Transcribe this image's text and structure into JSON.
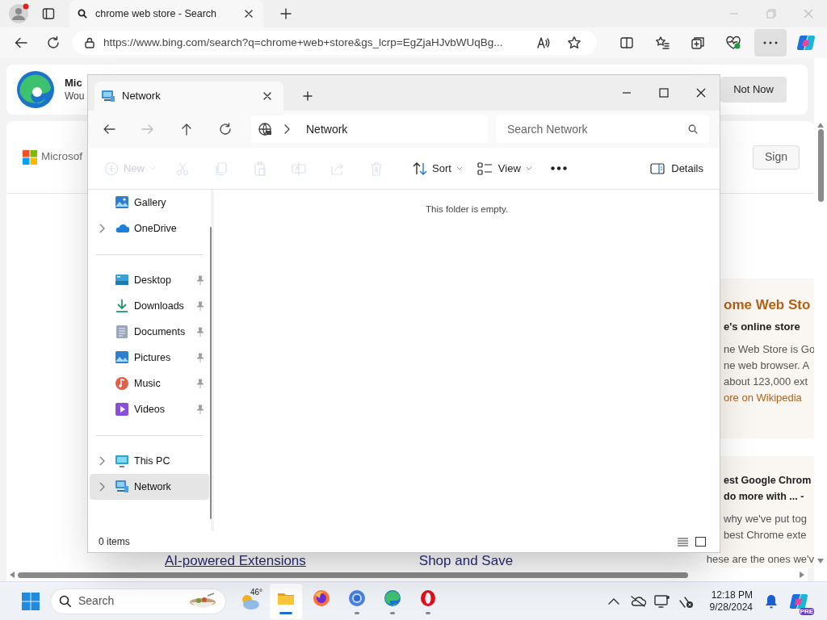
{
  "browser": {
    "tabs": [
      {
        "title": "chrome web store - Search",
        "selected": true
      }
    ],
    "address": "https://www.bing.com/search?q=chrome+web+store&gs_lcrp=EgZjaHJvbWUqBg...",
    "banner": {
      "title": "Mic",
      "subtitle": "Wou",
      "button": "Not Now"
    },
    "logo_text": "Microsof",
    "sign_in": "Sign",
    "cards": [
      {
        "title": "ome Web Sto",
        "subtitle": "e's online store",
        "lines": [
          "ne Web Store is Go",
          "ne web browser. A",
          "about 123,000 ext"
        ],
        "link": "ore on Wikipedia"
      },
      {
        "title": "est Google Chrom",
        "subtitle": "do more with ... -",
        "lines": [
          "why we've put tog",
          "best Chrome exte",
          "hese are the ones we'v"
        ]
      }
    ],
    "links": [
      "AI-powered Extensions",
      "Shop and Save"
    ]
  },
  "explorer": {
    "tabs": [
      {
        "title": "Network",
        "selected": true
      }
    ],
    "path": "Network",
    "search": {
      "placeholder": "Search Network"
    },
    "toolbar": [
      {
        "kind": "new",
        "label": "New",
        "disabled": true
      },
      {
        "kind": "cut",
        "disabled": true
      },
      {
        "kind": "copy",
        "disabled": true
      },
      {
        "kind": "paste",
        "disabled": true
      },
      {
        "kind": "rename",
        "disabled": true
      },
      {
        "kind": "share",
        "disabled": true
      },
      {
        "kind": "delete",
        "disabled": true
      },
      {
        "kind": "sort",
        "label": "Sort",
        "disabled": false
      },
      {
        "kind": "view",
        "label": "View",
        "disabled": false
      },
      {
        "kind": "more",
        "disabled": false
      }
    ],
    "details": "Details",
    "sidebar": [
      [
        {
          "label": "Gallery",
          "kind": "gallery",
          "has_children": false,
          "pinned": false,
          "selected": false
        },
        {
          "label": "OneDrive",
          "kind": "cloud",
          "has_children": true,
          "pinned": false,
          "selected": false
        }
      ],
      [
        {
          "label": "Desktop",
          "kind": "desktop",
          "has_children": false,
          "pinned": true,
          "selected": false
        },
        {
          "label": "Downloads",
          "kind": "download",
          "has_children": false,
          "pinned": true,
          "selected": false
        },
        {
          "label": "Documents",
          "kind": "document",
          "has_children": false,
          "pinned": true,
          "selected": false
        },
        {
          "label": "Pictures",
          "kind": "pictures",
          "has_children": false,
          "pinned": true,
          "selected": false
        },
        {
          "label": "Music",
          "kind": "music",
          "has_children": false,
          "pinned": true,
          "selected": false
        },
        {
          "label": "Videos",
          "kind": "videos",
          "has_children": false,
          "pinned": true,
          "selected": false
        }
      ],
      [
        {
          "label": "This PC",
          "kind": "pc",
          "has_children": true,
          "pinned": false,
          "selected": false
        },
        {
          "label": "Network",
          "kind": "network",
          "has_children": true,
          "pinned": false,
          "selected": true
        }
      ]
    ],
    "empty_message": "This folder is empty.",
    "status": "0 items"
  },
  "taskbar": {
    "search": {
      "placeholder": "Search"
    },
    "weather": "46°",
    "apps": [
      {
        "kind": "explorer",
        "running": true,
        "active": true
      },
      {
        "kind": "firefox",
        "running": false,
        "active": false
      },
      {
        "kind": "chrome",
        "running": true,
        "active": false
      },
      {
        "kind": "edge",
        "running": true,
        "active": false
      },
      {
        "kind": "opera",
        "running": true,
        "active": false
      }
    ],
    "time": "12:18 PM",
    "date": "9/28/2024",
    "copilot_badge": "PRE"
  }
}
